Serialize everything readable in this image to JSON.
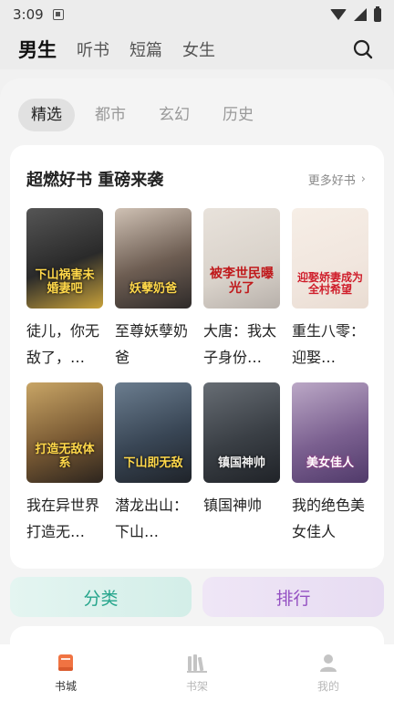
{
  "status_bar": {
    "time": "3:09"
  },
  "top_nav": {
    "tabs": [
      {
        "label": "男生"
      },
      {
        "label": "听书"
      },
      {
        "label": "短篇"
      },
      {
        "label": "女生"
      }
    ],
    "active": "男生"
  },
  "sub_tabs": [
    {
      "label": "精选"
    },
    {
      "label": "都市"
    },
    {
      "label": "玄幻"
    },
    {
      "label": "历史"
    }
  ],
  "section": {
    "title": "超燃好书 重磅来袭",
    "more_label": "更多好书",
    "books": [
      {
        "title": "徒儿，你无敌了，…",
        "cover_text": "下山祸害未婚妻吧"
      },
      {
        "title": "至尊妖孽奶爸",
        "cover_text": "妖孽奶爸"
      },
      {
        "title": "大唐：我太子身份…",
        "cover_text": "被李世民曝光了"
      },
      {
        "title": "重生八零：迎娶…",
        "cover_text": "迎娶娇妻成为全村希望"
      },
      {
        "title": "我在异世界打造无…",
        "cover_text": "打造无敌体系"
      },
      {
        "title": "潜龙出山：下山…",
        "cover_text": "下山即无敌"
      },
      {
        "title": "镇国神帅",
        "cover_text": "镇国神帅"
      },
      {
        "title": "我的绝色美女佳人",
        "cover_text": "美女佳人"
      }
    ]
  },
  "buttons": {
    "category": "分类",
    "ranking": "排行"
  },
  "bottom_nav": {
    "items": [
      {
        "label": "书城"
      },
      {
        "label": "书架"
      },
      {
        "label": "我的"
      }
    ],
    "active": "书城"
  },
  "colors": {
    "accent_orange": "#f07342",
    "category_green": "#26a58c",
    "ranking_purple": "#9450c2"
  }
}
